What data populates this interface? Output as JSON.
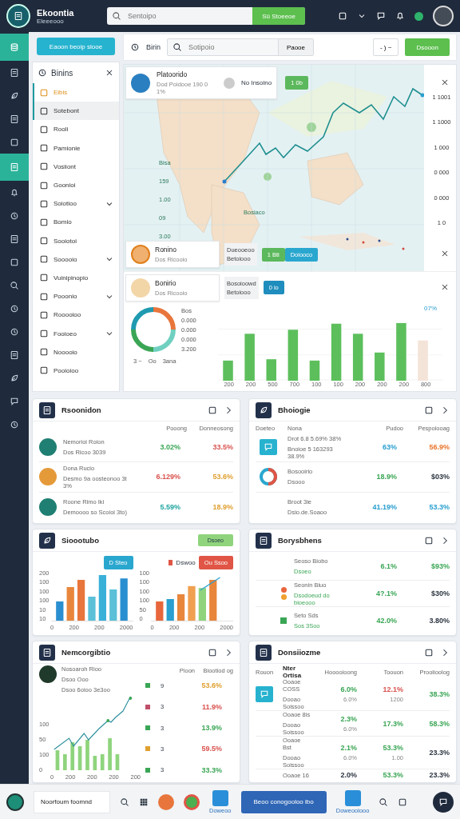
{
  "topbar": {
    "brand": "Ekoontia",
    "brand_sub": "Eleeeooo",
    "search": {
      "placeholder": "Sentoipo"
    },
    "search_button": "Sü Stoeeoe"
  },
  "rail": [
    {
      "selected": true
    },
    {
      "selected": false
    },
    {
      "selected": false
    },
    {
      "selected": false
    },
    {
      "selected": false
    },
    {
      "selected": true
    },
    {
      "selected": false
    },
    {
      "selected": false
    },
    {
      "selected": false
    },
    {
      "selected": false
    },
    {
      "selected": false
    },
    {
      "selected": false
    },
    {
      "selected": false
    },
    {
      "selected": false
    },
    {
      "selected": false
    },
    {
      "selected": false
    },
    {
      "selected": false
    }
  ],
  "sidebar": {
    "button": "Eaoon beoip slooe",
    "title": "Binins",
    "items": [
      {
        "label": "Eibis",
        "kind": "accent",
        "selected": false
      },
      {
        "label": "Sotebont",
        "kind": "link",
        "selected": true
      },
      {
        "label": "Rooli",
        "kind": "link",
        "selected": false
      },
      {
        "label": "Pamionie",
        "kind": "link",
        "selected": false
      },
      {
        "label": "Vosiiont",
        "kind": "link",
        "selected": false
      },
      {
        "label": "Goonioi",
        "kind": "link",
        "selected": false
      },
      {
        "label": "Soiotioo",
        "kind": "group",
        "selected": false
      },
      {
        "label": "Bomio",
        "kind": "link",
        "selected": false
      },
      {
        "label": "Sooiotoi",
        "kind": "link",
        "selected": false
      },
      {
        "label": "Sooooio",
        "kind": "group",
        "selected": false
      },
      {
        "label": "Vuinipinopio",
        "kind": "link",
        "selected": false
      },
      {
        "label": "Pooonio",
        "kind": "group",
        "selected": false
      },
      {
        "label": "Rooooioo",
        "kind": "link",
        "selected": false
      },
      {
        "label": "Fooioeo",
        "kind": "group",
        "selected": false
      },
      {
        "label": "Nooooio",
        "kind": "link",
        "selected": false
      },
      {
        "label": "Pooioioo",
        "kind": "link",
        "selected": false
      }
    ]
  },
  "toolbar": {
    "title": "Birin",
    "search": {
      "placeholder": "Sotipoio"
    },
    "search_button": "Paooe",
    "dropdown": "- ) ~",
    "action": "Dsooon"
  },
  "map": {
    "left_labels": [
      "Bisa",
      "159",
      "1.00",
      "09",
      "3.00"
    ],
    "right_labels": [
      "1 1001",
      "1 1000",
      "1 000",
      "0 000",
      "0 000",
      "1 0"
    ],
    "place_label": "Bosiaco",
    "top_card": {
      "title": "Platoorido",
      "subtitle": "Dod Poidooe 190 0 1%",
      "second": "No Insoino",
      "chip": "1 0b"
    },
    "mid_card": {
      "title": "Ronino",
      "subtitle": "Dos Ricooio",
      "note": [
        "Dueooeoo",
        "Betoiooo"
      ],
      "chips": [
        {
          "label": "1 Bti",
          "color": "#5cb85c"
        },
        {
          "label": "Doiooco",
          "color": "#2aa7cf"
        }
      ]
    }
  },
  "lower": {
    "card": {
      "title": "Bonirio",
      "subtitle": "Dos Ricooio",
      "note": [
        "Bosoioowd",
        "Betoiooo"
      ],
      "chips": [
        {
          "label": "0 io",
          "color": "#1f8dbd"
        }
      ]
    },
    "donut_legend": [
      "Bos",
      "0.000",
      "0.000",
      "0.000",
      "3.200"
    ],
    "donut_footer": [
      "3 ~",
      "Oo",
      "3ana"
    ],
    "bar_labels": [
      "200",
      "200",
      "500",
      "700",
      "100",
      "100",
      "200",
      "200",
      "200",
      "800"
    ],
    "bar_note": "07%"
  },
  "cards": [
    {
      "kind": "people",
      "title": "Rsoonidon",
      "columns": [
        "Pooong",
        "Donneosong"
      ],
      "rows": [
        {
          "name": "Nemorioi Roion",
          "sub": "Dos Ricoo 3039",
          "color": "#1f7f72",
          "a": {
            "text": "3.02%",
            "color": "#3aa655"
          },
          "b": {
            "text": "33.5%",
            "color": "#d9534f"
          }
        },
        {
          "name": "Dona Rucio",
          "sub": "Desmo 9a oosteonoo 3t 3%",
          "color": "#e59a3a",
          "a": {
            "text": "6.129%",
            "color": "#d9534f"
          },
          "b": {
            "text": "53.6%",
            "color": "#e0a030"
          }
        },
        {
          "name": "Roone Rimo Iki",
          "sub": "Demoooo so Scoioi 3to)",
          "color": "#1f7f72",
          "a": {
            "text": "5.59%",
            "color": "#22a6a0"
          },
          "b": {
            "text": "18.9%",
            "color": "#e0a030"
          }
        }
      ]
    },
    {
      "kind": "table",
      "title": "Bhoiogie",
      "columns": [
        "Doeteo",
        "Nona",
        "Pudoo",
        "Pespoiooag"
      ],
      "rows": [
        {
          "lines": [
            "Drot 6.8  5.69%  38%",
            "Bnoioe 5 163293  38.9%"
          ],
          "a": {
            "text": "63%",
            "color": "#2a9fd0"
          },
          "b": {
            "text": "56.9%",
            "color": "#e8762c"
          }
        },
        {
          "lines": [
            "Bosooirio",
            "Dsooo"
          ],
          "a": {
            "text": "18.9%",
            "color": "#3aa655"
          },
          "b": {
            "text": "$03%",
            "color": "#2b3440"
          }
        },
        {
          "lines": [
            "Broot 3ie",
            "Dsio.de.Soaoo"
          ],
          "a": {
            "text": "41.19%",
            "color": "#2a9fd0"
          },
          "b": {
            "text": "53.3%",
            "color": "#2a9fd0"
          }
        }
      ]
    },
    {
      "kind": "bars",
      "title": "Sioootubo",
      "button": "Dsoeo",
      "charts": [
        {
          "chip": {
            "label": "D Steo",
            "color": "#2aa7cf"
          },
          "y_labels": [
            "200",
            "100",
            "100",
            "100",
            "10",
            "10"
          ],
          "x_labels": [
            "0",
            "200",
            "200",
            "2000"
          ]
        },
        {
          "chip": {
            "label": "Ou Ssoo",
            "color": "#e05545"
          },
          "legend": "Dswoo",
          "y_labels": [
            "100",
            "100",
            "100",
            "100",
            "50",
            "0"
          ],
          "x_labels": [
            "0",
            "200",
            "200",
            "2000"
          ]
        }
      ]
    },
    {
      "kind": "rows",
      "title": "Borysbhens",
      "rows": [
        {
          "title": "Seoso Biobo",
          "sub": "Dsoeo",
          "a": {
            "text": "6.1%",
            "color": "#3aa655"
          },
          "b": {
            "text": "$93%",
            "color": "#3aa655"
          }
        },
        {
          "title": "Seonin Biuo",
          "sub": "Dsodoeud do bioeooo",
          "a": {
            "text": "4?.1%",
            "color": "#3aa655"
          },
          "b": {
            "text": "$30%",
            "color": "#2b3440"
          }
        },
        {
          "title": "Seto Sds",
          "sub": "Sos 3Soo",
          "a": {
            "text": "42.0%",
            "color": "#3aa655"
          },
          "b": {
            "text": "3.80%",
            "color": "#2b3440"
          }
        }
      ]
    },
    {
      "kind": "trend",
      "title": "Nemcorgibtio",
      "head": {
        "title": "Nosoaroh Rioo",
        "lines": [
          "Dsoo Ooo",
          "Dsoo 6oioo 3e3oo"
        ]
      },
      "columns": [
        "Pioon",
        "Biootiod og"
      ],
      "y_labels": [
        "100",
        "50",
        "100",
        "0"
      ],
      "x_labels": [
        "0",
        "200",
        "200",
        "200",
        "200"
      ],
      "list": [
        {
          "color": "#3aa655",
          "n": "9",
          "v": {
            "text": "53.6%",
            "color": "#e0a030"
          }
        },
        {
          "color": "#c0506a",
          "n": "3",
          "v": {
            "text": "11.9%",
            "color": "#d9534f"
          }
        },
        {
          "color": "#3aa655",
          "n": "3",
          "v": {
            "text": "13.9%",
            "color": "#3aa655"
          }
        },
        {
          "color": "#e0a030",
          "n": "3",
          "v": {
            "text": "59.5%",
            "color": "#d9534f"
          }
        },
        {
          "color": "#3aa655",
          "n": "3",
          "v": {
            "text": "33.3%",
            "color": "#3aa655"
          }
        }
      ]
    },
    {
      "kind": "orders",
      "title": "Donsiiozme",
      "columns": [
        "Rouon",
        "Nter Ortisa",
        "Hooooioong",
        "Toouon",
        "Prooiioolog"
      ],
      "rows": [
        {
          "name": "Ooaoe COSS",
          "sub": "Dooao Soissoo",
          "c": {
            "text": "6.0%",
            "color": "#3aa655"
          },
          "c2": "6.0%",
          "d": {
            "text": "12.1%",
            "color": "#d9534f"
          },
          "d2": "1200",
          "e": {
            "text": "38.3%",
            "color": "#3aa655"
          }
        },
        {
          "name": "Ooaoe 8is",
          "sub": "Dooao Soissoo",
          "c": {
            "text": "2.3%",
            "color": "#3aa655"
          },
          "c2": "6.0%",
          "d": {
            "text": "17.3%",
            "color": "#3aa655"
          },
          "e": {
            "text": "58.3%",
            "color": "#3aa655"
          }
        },
        {
          "name": "Ooaoe Bst",
          "sub": "Dooao Soissoo",
          "c": {
            "text": "2.1%",
            "color": "#3aa655"
          },
          "c2": "6.0%",
          "d": {
            "text": "53.3%",
            "color": "#3aa655"
          },
          "d2": "1.00",
          "e": {
            "text": "23.3%",
            "color": "#2b3440"
          }
        },
        {
          "name": "Ooaoe 16",
          "c": {
            "text": "2.0%",
            "color": "#2b3440"
          },
          "d": {
            "text": "53.3%",
            "color": "#3aa655"
          },
          "e": {
            "text": "23.3%",
            "color": "#2b3440"
          }
        }
      ]
    }
  ],
  "bottombar": {
    "field": "Noorfoum foomnd",
    "apps": [
      "Doweoo",
      "Doweooiooo"
    ],
    "button": "Beoo conogooloo ibo"
  }
}
